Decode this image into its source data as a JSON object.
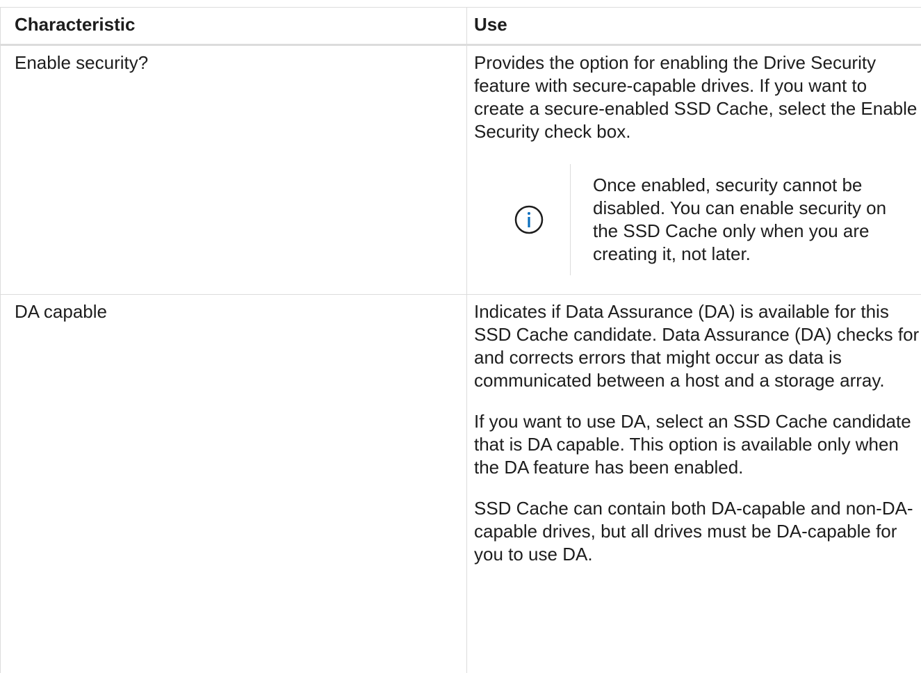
{
  "table": {
    "headers": {
      "characteristic": "Characteristic",
      "use": "Use"
    },
    "rows": [
      {
        "characteristic": "Enable security?",
        "use_paragraphs": [
          "Provides the option for enabling the Drive Security feature with secure-capable drives. If you want to create a secure-enabled SSD Cache, select the Enable Security check box."
        ],
        "note": {
          "icon": "info-icon",
          "text": "Once enabled, security cannot be disabled. You can enable security on the SSD Cache only when you are creating it, not later."
        }
      },
      {
        "characteristic": "DA capable",
        "use_paragraphs": [
          "Indicates if Data Assurance (DA) is available for this SSD Cache candidate. Data Assurance (DA) checks for and corrects errors that might occur as data is communicated between a host and a storage array.",
          "If you want to use DA, select an SSD Cache candidate that is DA capable. This option is available only when the DA feature has been enabled.",
          "SSD Cache can contain both DA-capable and non-DA-capable drives, but all drives must be DA-capable for you to use DA."
        ]
      }
    ]
  },
  "colors": {
    "text": "#1d1d1d",
    "border": "#dcdcdc",
    "info_icon": "#0a6ebd"
  }
}
